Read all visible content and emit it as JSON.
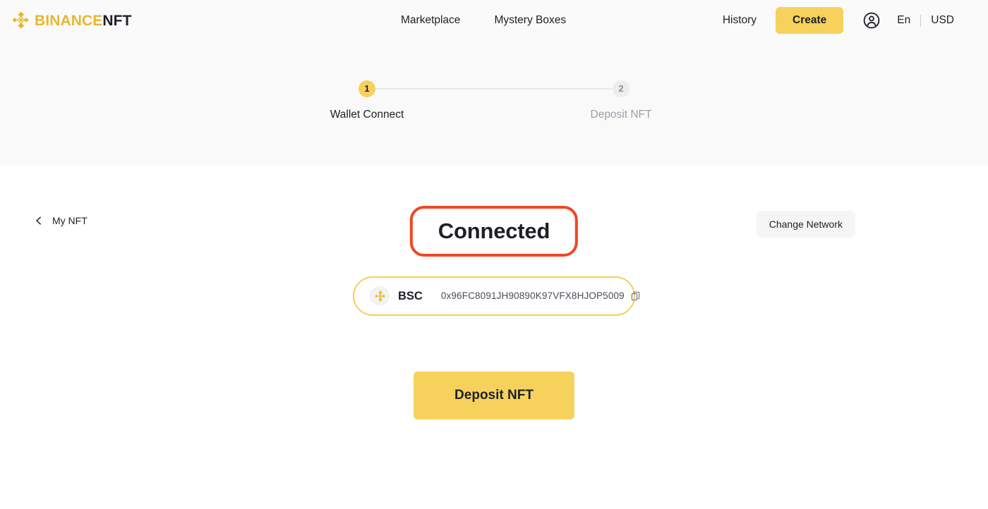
{
  "header": {
    "brand": {
      "binance": "BINANCE",
      "nft": "NFT",
      "logo_icon": "binance-diamond-logo"
    },
    "nav": [
      {
        "label": "Marketplace"
      },
      {
        "label": "Mystery Boxes"
      }
    ],
    "history_label": "History",
    "create_label": "Create",
    "account_icon": "account-circle-icon",
    "language": "En",
    "currency": "USD",
    "create_color": "#F6D25C"
  },
  "stepper": {
    "steps": [
      {
        "number": "1",
        "label": "Wallet Connect",
        "state": "active"
      },
      {
        "number": "2",
        "label": "Deposit NFT",
        "state": "inactive"
      }
    ],
    "active_color": "#F6D25C",
    "inactive_color": "#EDEDED"
  },
  "main": {
    "back_label": "My NFT",
    "back_icon": "chevron-left-icon",
    "change_network_label": "Change Network",
    "status_title": "Connected",
    "highlight_color": "#EF4722",
    "wallet": {
      "network_icon": "binance-smart-chain-icon",
      "network": "BSC",
      "address": "0x96FC8091JH90890K97VFX8HJOP5009",
      "copy_icon": "copy-icon",
      "border_color": "#F3CF5C"
    },
    "deposit_label": "Deposit NFT",
    "deposit_color": "#F6D25C"
  }
}
